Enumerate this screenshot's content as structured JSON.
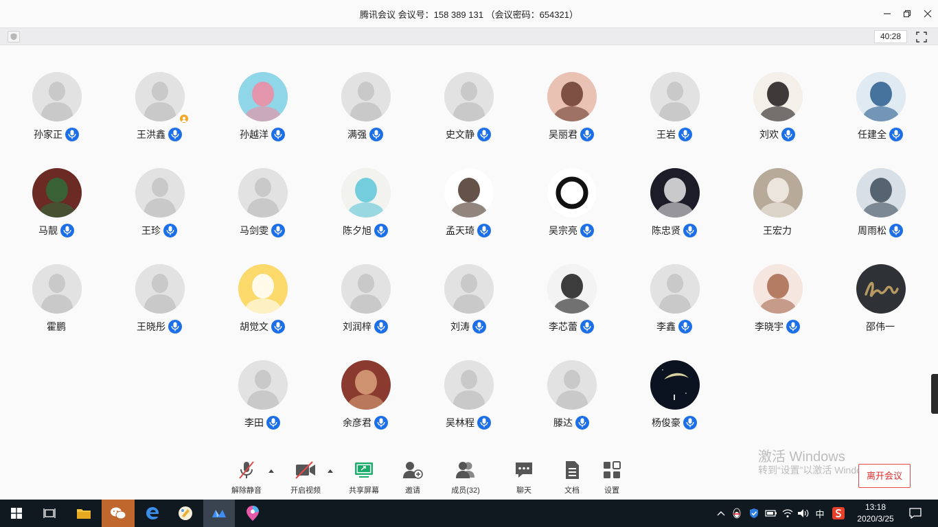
{
  "window": {
    "title": "腾讯会议 会议号：158 389 131 （会议密码：654321）",
    "timer": "40:28"
  },
  "participants": [
    {
      "name": "孙家正",
      "avatar": "default",
      "mic": true
    },
    {
      "name": "王洪鑫",
      "avatar": "default",
      "mic": true,
      "host": true
    },
    {
      "name": "孙越洋",
      "avatar": "patrick-star-photo",
      "mic": true
    },
    {
      "name": "满强",
      "avatar": "default",
      "mic": true
    },
    {
      "name": "史文静",
      "avatar": "default",
      "mic": true
    },
    {
      "name": "吴丽君",
      "avatar": "selfie-photo",
      "mic": true
    },
    {
      "name": "王岩",
      "avatar": "default",
      "mic": true
    },
    {
      "name": "刘欢",
      "avatar": "anime-girl-photo",
      "mic": true
    },
    {
      "name": "任建全",
      "avatar": "anime-character-photo",
      "mic": true
    },
    {
      "name": "马靓",
      "avatar": "figurines-photo",
      "mic": true
    },
    {
      "name": "王珍",
      "avatar": "default",
      "mic": true
    },
    {
      "name": "马剑雯",
      "avatar": "default",
      "mic": true
    },
    {
      "name": "陈夕旭",
      "avatar": "cartoon-face-drawing",
      "mic": true
    },
    {
      "name": "孟天琦",
      "avatar": "cartoon-girl-drawing",
      "mic": true
    },
    {
      "name": "吴宗亮",
      "avatar": "ink-circle-logo",
      "mic": true
    },
    {
      "name": "陈忠贤",
      "avatar": "astronauts-photo",
      "mic": true
    },
    {
      "name": "王宏力",
      "avatar": "cats-photo",
      "mic": false
    },
    {
      "name": "周雨松",
      "avatar": "landscape-photo",
      "mic": true
    },
    {
      "name": "霍鹏",
      "avatar": "default",
      "mic": false
    },
    {
      "name": "王晓彤",
      "avatar": "default",
      "mic": true
    },
    {
      "name": "胡觉文",
      "avatar": "yellow-cartoon-drawing",
      "mic": true
    },
    {
      "name": "刘润梓",
      "avatar": "default",
      "mic": true
    },
    {
      "name": "刘涛",
      "avatar": "default",
      "mic": true
    },
    {
      "name": "李芯蕾",
      "avatar": "penguin-costume-photo",
      "mic": true
    },
    {
      "name": "李鑫",
      "avatar": "default",
      "mic": true
    },
    {
      "name": "李晓宇",
      "avatar": "portrait-photo",
      "mic": true
    },
    {
      "name": "邵伟一",
      "avatar": "hello-lettering-logo",
      "mic": false
    },
    {
      "name": "李田",
      "avatar": "default",
      "mic": true
    },
    {
      "name": "余彦君",
      "avatar": "man-face-photo",
      "mic": true
    },
    {
      "name": "吴林程",
      "avatar": "default",
      "mic": true
    },
    {
      "name": "滕达",
      "avatar": "default",
      "mic": true
    },
    {
      "name": "杨俊豪",
      "avatar": "moon-night-photo",
      "mic": true
    }
  ],
  "controls": {
    "unmute": "解除静音",
    "start_video": "开启视频",
    "share_screen": "共享屏幕",
    "invite": "邀请",
    "members": "成员(32)",
    "chat": "聊天",
    "docs": "文档",
    "settings": "设置",
    "leave": "离开会议"
  },
  "watermark": {
    "line1": "激活 Windows",
    "line2": "转到“设置”以激活 Windows。"
  },
  "taskbar": {
    "time": "13:18",
    "date": "2020/3/25",
    "ime": "中"
  },
  "colors": {
    "accent": "#1d6fe8",
    "leave": "#e02b2b",
    "share_green": "#1aad6b"
  }
}
